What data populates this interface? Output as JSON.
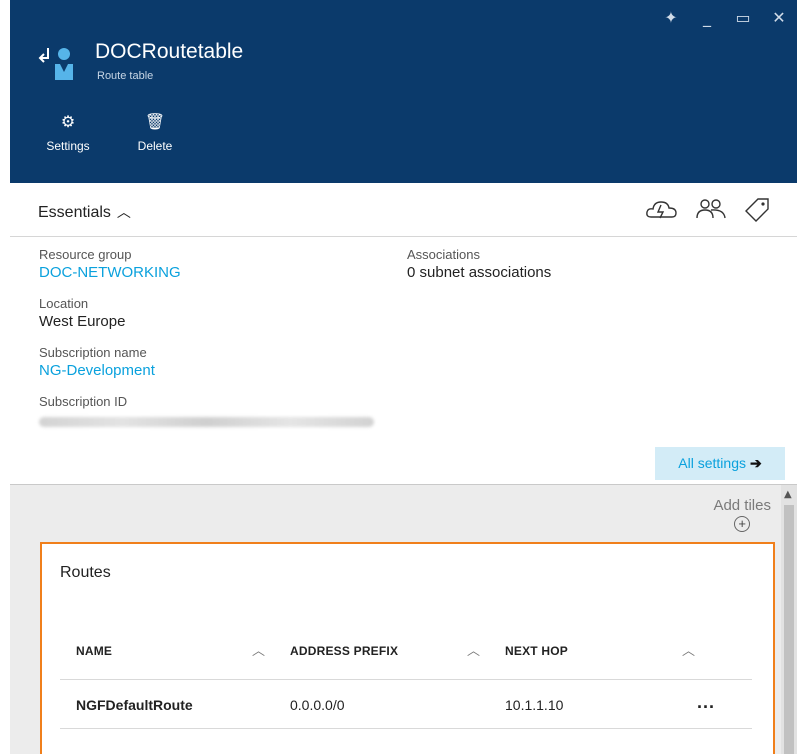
{
  "window": {
    "controls": [
      "pin-icon",
      "minimize-icon",
      "maximize-icon",
      "close-icon"
    ]
  },
  "resource": {
    "name": "DOCRoutetable",
    "type": "Route table"
  },
  "commands": [
    {
      "label": "Settings",
      "icon": "gear-icon"
    },
    {
      "label": "Delete",
      "icon": "trash-icon"
    }
  ],
  "essentials": {
    "title": "Essentials",
    "icons": [
      "cloud-icon",
      "users-icon",
      "tag-icon"
    ],
    "resource_group": {
      "label": "Resource group",
      "value": "DOC-NETWORKING"
    },
    "location": {
      "label": "Location",
      "value": "West Europe"
    },
    "subscription_name": {
      "label": "Subscription name",
      "value": "NG-Development"
    },
    "subscription_id": {
      "label": "Subscription ID",
      "value": ""
    },
    "associations": {
      "label": "Associations",
      "value": "0 subnet associations"
    },
    "all_settings": "All settings"
  },
  "tiles": {
    "add_tiles": "Add tiles",
    "routes": {
      "title": "Routes",
      "columns": [
        "NAME",
        "ADDRESS PREFIX",
        "NEXT HOP"
      ],
      "rows": [
        {
          "name": "NGFDefaultRoute",
          "address_prefix": "0.0.0.0/0",
          "next_hop": "10.1.1.10",
          "more": "..."
        }
      ]
    }
  },
  "colors": {
    "header_bg": "#0b3a6b",
    "link": "#0aa1dd",
    "tile_border": "#f07f1b"
  }
}
